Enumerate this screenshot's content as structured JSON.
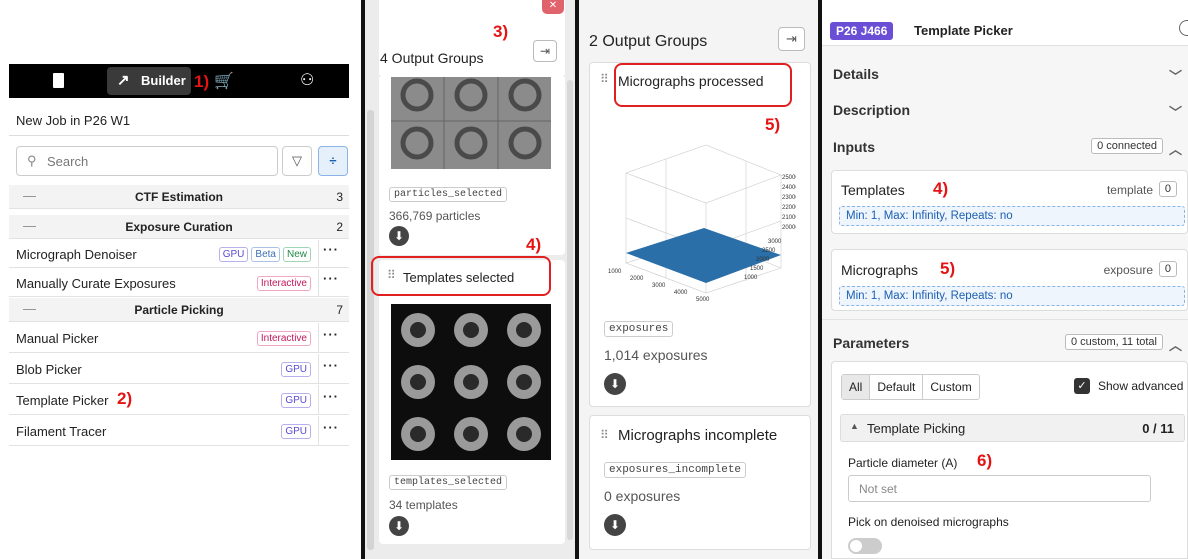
{
  "markers": {
    "m1": "1)",
    "m2": "2)",
    "m3": "3)",
    "m4a": "4)",
    "m4b": "4)",
    "m5a": "5)",
    "m5b": "5)",
    "m6": "6)",
    "m4c": "4)"
  },
  "builder": {
    "tab_label": "Builder",
    "job_title": "New Job in P26 W1",
    "search_placeholder": "Search",
    "categories": [
      {
        "label": "CTF Estimation",
        "count": "3"
      },
      {
        "label": "Exposure Curation",
        "count": "2"
      },
      {
        "label": "Particle Picking",
        "count": "7"
      }
    ],
    "jobs": [
      {
        "label": "Micrograph Denoiser",
        "tags": [
          "GPU",
          "Beta",
          "New"
        ]
      },
      {
        "label": "Manually Curate Exposures",
        "tags": [
          "Interactive"
        ]
      },
      {
        "label": "Manual Picker",
        "tags": [
          "Interactive"
        ]
      },
      {
        "label": "Blob Picker",
        "tags": [
          "GPU"
        ]
      },
      {
        "label": "Template Picker",
        "tags": [
          "GPU"
        ]
      },
      {
        "label": "Filament Tracer",
        "tags": [
          "GPU"
        ]
      }
    ],
    "more": "···"
  },
  "groups4": {
    "title": "4 Output Groups",
    "group1_slot": "particles_selected",
    "group1_count": "366,769 particles",
    "group2_title": "Templates selected",
    "group2_slot": "templates_selected",
    "group2_count": "34 templates"
  },
  "groups2": {
    "title": "2 Output Groups",
    "group1_title": "Micrographs processed",
    "group1_slot": "exposures",
    "group1_count": "1,014 exposures",
    "group2_title": "Micrographs incomplete",
    "group2_slot": "exposures_incomplete",
    "group2_count": "0 exposures",
    "plot_z_ticks": [
      "25000",
      "24000",
      "23000",
      "22000",
      "21000",
      "20000"
    ],
    "plot_x_ticks": [
      "1000",
      "2000",
      "3000",
      "4000",
      "5000"
    ],
    "plot_y_ticks": [
      "3000",
      "2500",
      "2000",
      "1500",
      "1000"
    ]
  },
  "picker": {
    "job_badge": "P26 J466",
    "title": "Template Picker",
    "details": "Details",
    "description": "Description",
    "inputs": "Inputs",
    "inputs_status": "0 connected",
    "templates_label": "Templates",
    "templates_type": "template",
    "templates_count": "0",
    "templates_rule": "Min: 1, Max: Infinity, Repeats: no",
    "micrographs_label": "Micrographs",
    "micrographs_type": "exposure",
    "micrographs_count": "0",
    "micrographs_rule": "Min: 1, Max: Infinity, Repeats: no",
    "parameters": "Parameters",
    "parameters_status": "0 custom, 11 total",
    "filter_all": "All",
    "filter_default": "Default",
    "filter_custom": "Custom",
    "show_advanced": "Show advanced",
    "section": "Template Picking",
    "section_count": "0 / 11",
    "param1_label": "Particle diameter (A)",
    "param1_placeholder": "Not set",
    "param2_label": "Pick on denoised micrographs"
  },
  "colors": {
    "accent": "#6a4fd6",
    "surface": "#2a6fa8",
    "marker": "#e41414"
  }
}
